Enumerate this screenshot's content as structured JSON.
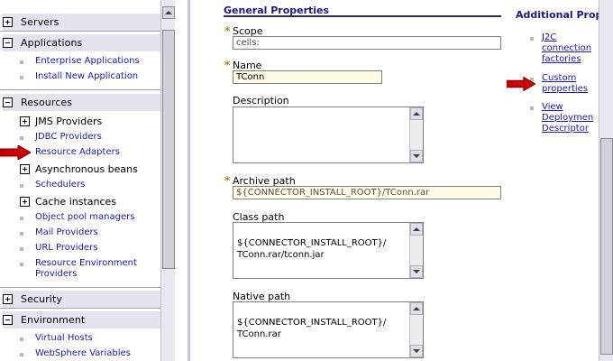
{
  "nav": {
    "sections": [
      {
        "label": "Servers",
        "state": "collapsed"
      },
      {
        "label": "Applications",
        "state": "expanded"
      },
      {
        "label": "Resources",
        "state": "expanded"
      },
      {
        "label": "Security",
        "state": "collapsed"
      },
      {
        "label": "Environment",
        "state": "expanded"
      }
    ],
    "applications": [
      "Enterprise Applications",
      "Install New Application"
    ],
    "resources": [
      {
        "label": "JMS Providers",
        "expandable": true
      },
      {
        "label": "JDBC Providers",
        "expandable": false
      },
      {
        "label": "Resource Adapters",
        "expandable": false,
        "selected": true
      },
      {
        "label": "Asynchronous beans",
        "expandable": true
      },
      {
        "label": "Schedulers",
        "expandable": false
      },
      {
        "label": "Cache instances",
        "expandable": true
      },
      {
        "label": "Object pool managers",
        "expandable": false
      },
      {
        "label": "Mail Providers",
        "expandable": false
      },
      {
        "label": "URL Providers",
        "expandable": false
      },
      {
        "label": "Resource Environment Providers",
        "expandable": false
      }
    ],
    "environment": [
      "Virtual Hosts",
      "WebSphere Variables"
    ]
  },
  "form": {
    "section_title": "General Properties",
    "scope": {
      "label": "Scope",
      "value": "cells:"
    },
    "name": {
      "label": "Name",
      "value": "TConn"
    },
    "description": {
      "label": "Description",
      "value": ""
    },
    "archive_path": {
      "label": "Archive path",
      "value": "${CONNECTOR_INSTALL_ROOT}/TConn.rar"
    },
    "class_path": {
      "label": "Class path",
      "value": "${CONNECTOR_INSTALL_ROOT}/\nTConn.rar/tconn.jar"
    },
    "native_path": {
      "label": "Native path",
      "value": "${CONNECTOR_INSTALL_ROOT}/\nTConn.rar"
    }
  },
  "additional": {
    "title": "Additional Prope",
    "links": [
      "J2C connection factories",
      "Custom properties",
      "View Deploymen Descriptor"
    ]
  },
  "colors": {
    "arrow": "#cc0000",
    "link": "#1a1ab8",
    "heading": "#1a1a80"
  },
  "icons": [
    "plus-icon",
    "minus-icon",
    "bullet-icon",
    "red-arrow-icon",
    "scroll-up-icon",
    "scroll-down-icon"
  ]
}
